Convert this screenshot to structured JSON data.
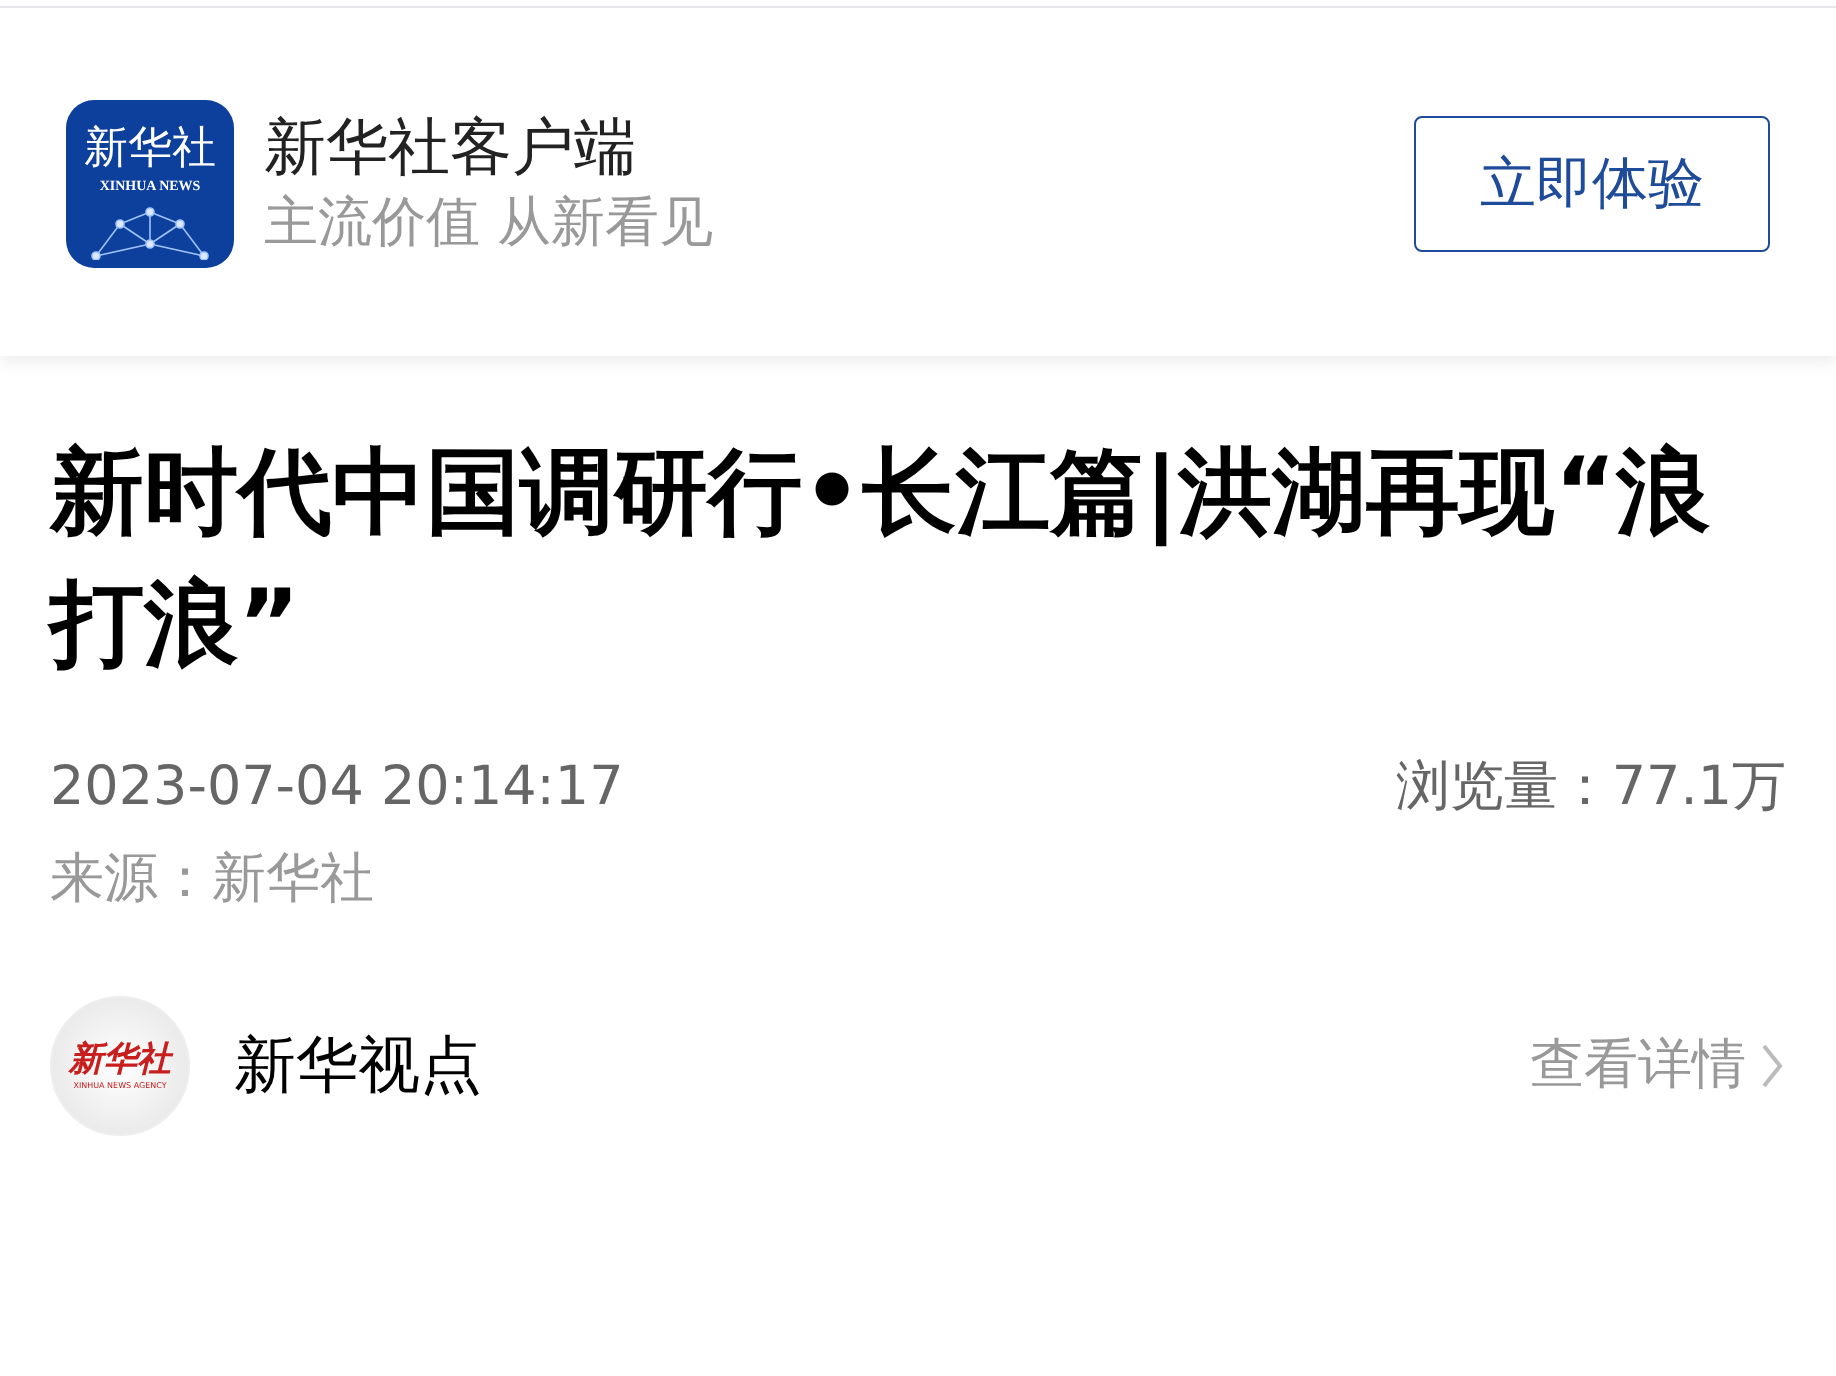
{
  "app_banner": {
    "icon": {
      "name": "新华社",
      "subtitle": "XINHUA NEWS"
    },
    "title": "新华社客户端",
    "slogan": "主流价值 从新看见",
    "button": "立即体验"
  },
  "article": {
    "headline": "新时代中国调研行•长江篇|洪湖再现“浪打浪”",
    "date": "2023-07-04 20:14:17",
    "views": "浏览量：77.1万",
    "source": "来源：新华社"
  },
  "account": {
    "avatar": {
      "name": "新华社",
      "subtitle": "XINHUA NEWS AGENCY"
    },
    "name": "新华视点",
    "link": "查看详情"
  }
}
